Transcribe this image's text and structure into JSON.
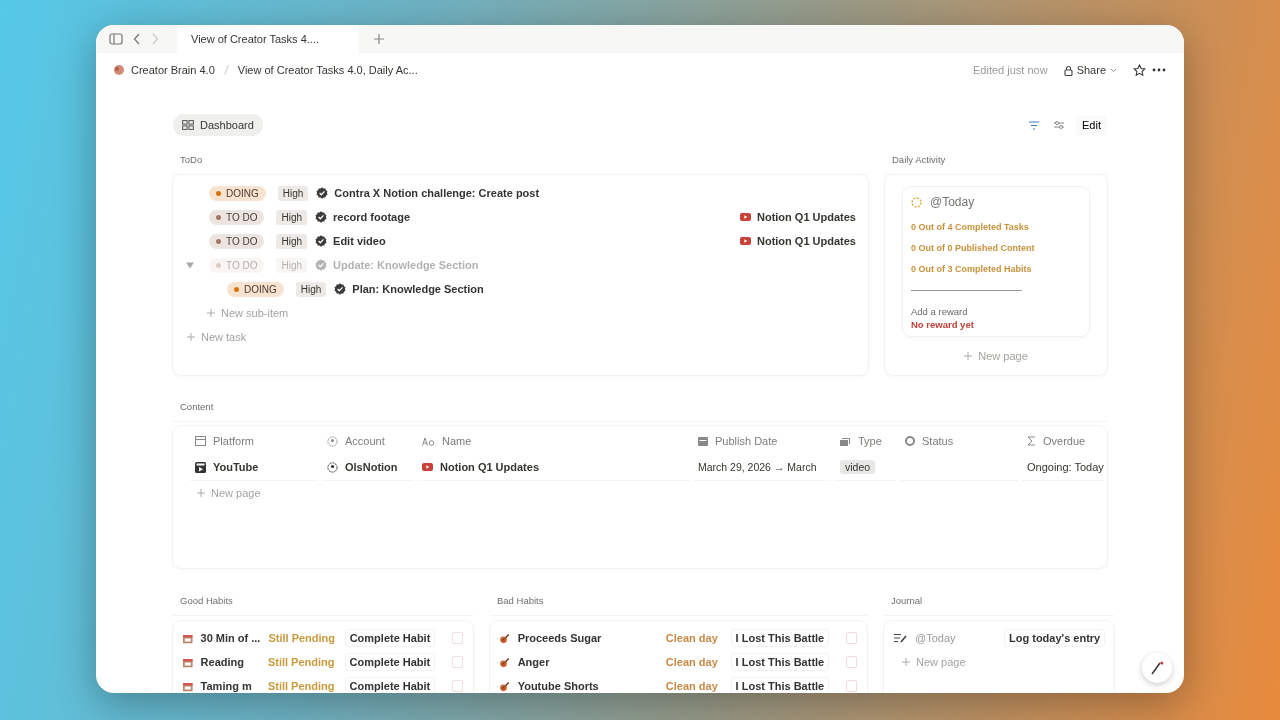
{
  "tab_bar": {
    "tab_title": "View of Creator Tasks 4...."
  },
  "breadcrumbs": [
    "Creator Brain 4.0",
    "View of Creator Tasks 4.0, Daily Ac..."
  ],
  "edited": "Edited just now",
  "share": "Share",
  "dashboard": {
    "title": "Dashboard",
    "edit": "Edit"
  },
  "todo": {
    "title": "ToDo",
    "new_task": "New task",
    "tasks": [
      {
        "status": "DOING",
        "color": "#d9730d",
        "priority": "High",
        "title": "Contra X Notion challenge: Create post",
        "dimmed": false
      },
      {
        "status": "TO DO",
        "color": "#a27763",
        "priority": "High",
        "title": "record footage",
        "project": "Notion Q1 Updates",
        "dimmed": false
      },
      {
        "status": "TO DO",
        "color": "#a27763",
        "priority": "High",
        "title": "Edit video",
        "project": "Notion Q1 Updates",
        "dimmed": false
      },
      {
        "status": "TO DO",
        "color": "#dccbc1",
        "priority": "High",
        "title": "Update: Knowledge Section",
        "dimmed": true,
        "expanded": true,
        "new_sub_item": "New sub-item",
        "children": [
          {
            "status": "DOING",
            "color": "#d9730d",
            "priority": "High",
            "title": "Plan: Knowledge Section",
            "dimmed": false
          }
        ]
      }
    ]
  },
  "daily_activity": {
    "title": "Daily Activity",
    "date": "@Today",
    "stats": [
      "0 Out of 4 Completed Tasks",
      "0 Out of 0 Published Content",
      "0 Out of 3 Completed Habits"
    ],
    "divider": "————————————-",
    "reward_label": "Add a reward",
    "reward_value": "No reward yet",
    "new_page": "New page"
  },
  "content": {
    "title": "Content",
    "columns": [
      "Platform",
      "Account",
      "Name",
      "Publish Date",
      "Type",
      "Status",
      "Overdue"
    ],
    "rows": [
      {
        "platform": "YouTube",
        "account": "OlsNotion",
        "name": "Notion Q1 Updates",
        "publish_date": "March 29, 2026 → March",
        "type": "video",
        "overdue": "Ongoing: Today"
      }
    ],
    "new_page": "New page"
  },
  "good_habits": {
    "title": "Good Habits",
    "items": [
      {
        "name": "30 Min of ...",
        "status": "Still Pending",
        "action": "Complete Habit",
        "checked": false
      },
      {
        "name": "Reading",
        "status": "Still Pending",
        "action": "Complete Habit",
        "checked": false
      },
      {
        "name": "Taming m",
        "status": "Still Pending",
        "action": "Complete Habit",
        "checked": false
      }
    ]
  },
  "bad_habits": {
    "title": "Bad Habits",
    "items": [
      {
        "name": "Proceeds Sugar",
        "status": "Clean day",
        "action": "I Lost This Battle",
        "checked": false
      },
      {
        "name": "Anger",
        "status": "Clean day",
        "action": "I Lost This Battle",
        "checked": false
      },
      {
        "name": "Youtube Shorts",
        "status": "Clean day",
        "action": "I Lost This Battle",
        "checked": false
      }
    ]
  },
  "journal": {
    "title": "Journal",
    "items": [
      {
        "date": "@Today",
        "action": "Log today's entry"
      }
    ],
    "new_page": "New page"
  }
}
